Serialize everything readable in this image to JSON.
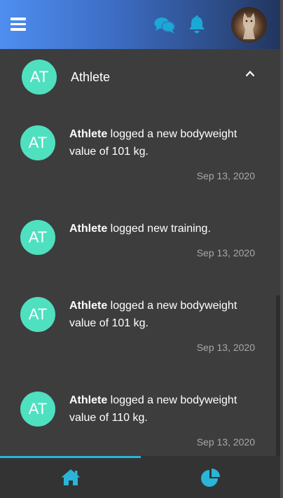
{
  "header": {
    "menu_icon": "hamburger-menu-icon",
    "chat_icon": "comments-icon",
    "bell_icon": "bell-icon",
    "avatar": "user-avatar-cat"
  },
  "colors": {
    "accent": "#2ab4d8",
    "avatar_teal": "#4fe0c0",
    "background": "#3d3d3d",
    "footer": "#333333"
  },
  "section": {
    "initials": "AT",
    "title": "Athlete",
    "toggle_icon": "chevron-up-icon"
  },
  "notifications": [
    {
      "initials": "AT",
      "actor": "Athlete",
      "message": " logged a new bodyweight value of 101 kg.",
      "date": "Sep 13, 2020"
    },
    {
      "initials": "AT",
      "actor": "Athlete",
      "message": " logged new training.",
      "date": "Sep 13, 2020"
    },
    {
      "initials": "AT",
      "actor": "Athlete",
      "message": " logged a new bodyweight value of 101 kg.",
      "date": "Sep 13, 2020"
    },
    {
      "initials": "AT",
      "actor": "Athlete",
      "message": " logged a new bodyweight value of 110 kg.",
      "date": "Sep 13, 2020"
    }
  ],
  "footer": {
    "tabs": [
      {
        "icon": "home-icon",
        "active": true
      },
      {
        "icon": "pie-chart-icon",
        "active": false
      }
    ]
  }
}
